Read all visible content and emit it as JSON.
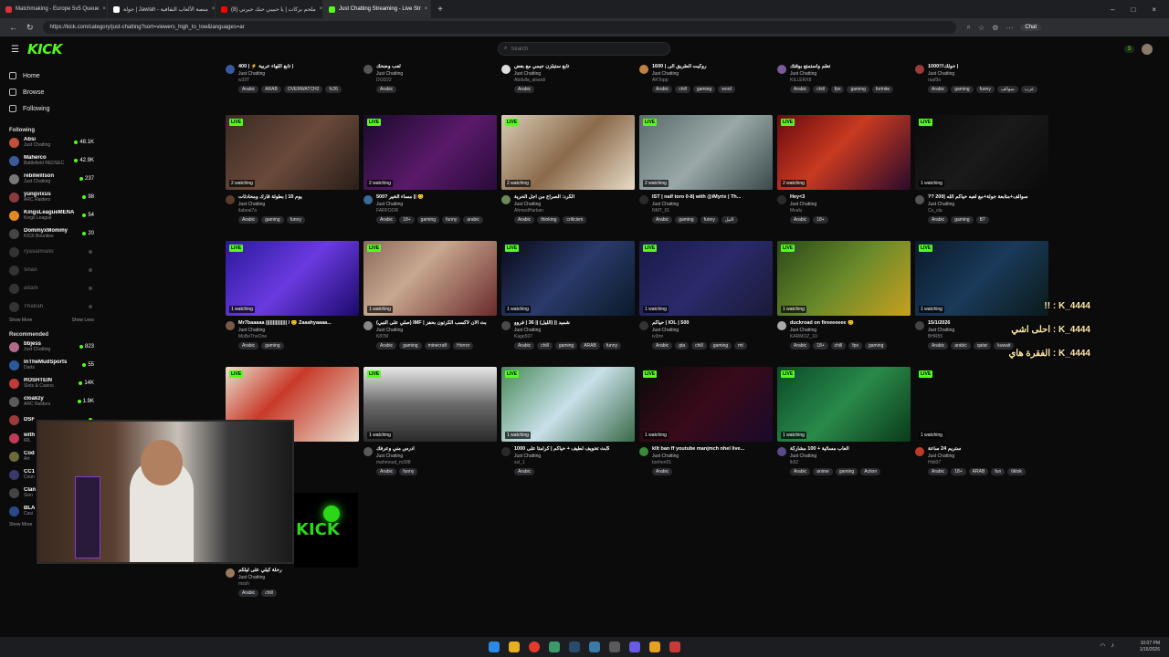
{
  "browser": {
    "tabs": [
      {
        "label": "Matchmaking - Europe 5v5 Queue",
        "color": "#e0313b"
      },
      {
        "label": "جولة | Jawlah - منصة الألعاب الثقافية",
        "color": "#ffffff"
      },
      {
        "label": "ملحم بركات | يا حبيبي حبك حيرني (8)",
        "color": "#ff0000"
      },
      {
        "label": "Just Chatting Streaming - Live Str",
        "color": "#53fc18"
      }
    ],
    "url": "https://kick.com/category/just-chatting?sort=viewers_high_to_low&languages=ar",
    "chat_label": "Chat"
  },
  "header": {
    "logo": "KICK",
    "search_placeholder": "Search",
    "notif_count": "3"
  },
  "sidebar": {
    "nav": [
      {
        "label": "Home"
      },
      {
        "label": "Browse"
      },
      {
        "label": "Following"
      }
    ],
    "following_title": "Following",
    "following": [
      {
        "name": "Absi",
        "category": "Just Chatting",
        "viewers": "48.1K",
        "color": "#c0503a",
        "online": true
      },
      {
        "name": "Maherco",
        "category": "Battlefield REDSEC",
        "viewers": "42.9K",
        "color": "#3a5a9a",
        "online": true
      },
      {
        "name": "rebilwillson",
        "category": "Just Chatting",
        "viewers": "237",
        "color": "#777",
        "online": true
      },
      {
        "name": "yungvixus",
        "category": "ARC Raiders",
        "viewers": "98",
        "color": "#8a3a3a",
        "online": true
      },
      {
        "name": "KingsLeagueMENA",
        "category": "Kings League",
        "viewers": "54",
        "color": "#e08a20",
        "online": true
      },
      {
        "name": "DommyxMommy",
        "category": "KICK Bounties",
        "viewers": "20",
        "color": "#444",
        "online": true
      },
      {
        "name": "ryasalmalki",
        "category": "",
        "viewers": "",
        "color": "#333",
        "online": false
      },
      {
        "name": "Snan",
        "category": "",
        "viewers": "",
        "color": "#333",
        "online": false
      },
      {
        "name": "aitam",
        "category": "",
        "viewers": "",
        "color": "#333",
        "online": false
      },
      {
        "name": "Thabah",
        "category": "",
        "viewers": "",
        "color": "#333",
        "online": false
      }
    ],
    "show_more": "Show More",
    "show_less": "Show Less",
    "recommended_title": "Recommended",
    "recommended": [
      {
        "name": "bbjess",
        "category": "Just Chatting",
        "viewers": "823",
        "color": "#b06a8a"
      },
      {
        "name": "InTheMudSports",
        "category": "Darts",
        "viewers": "55",
        "color": "#2a5a9a"
      },
      {
        "name": "ROSHTEIN",
        "category": "Slots & Casino",
        "viewers": "14K",
        "color": "#c03a3a"
      },
      {
        "name": "cloakzy",
        "category": "ARC Raiders",
        "viewers": "1.9K",
        "color": "#5a5a5a"
      },
      {
        "name": "DSF",
        "category": "",
        "viewers": "",
        "color": "#9a3a3a"
      },
      {
        "name": "with",
        "category": "IRL",
        "viewers": "",
        "color": "#c03a5a"
      },
      {
        "name": "Cod",
        "category": "Art",
        "viewers": "",
        "color": "#6a6a3a"
      },
      {
        "name": "CC1",
        "category": "Coun",
        "viewers": "",
        "color": "#3a3a6a"
      },
      {
        "name": "Clan",
        "category": "Sion",
        "viewers": "",
        "color": "#444"
      },
      {
        "name": "BLA",
        "category": "Casi",
        "viewers": "",
        "color": "#2a4a8a"
      }
    ],
    "show_more_2": "Show More"
  },
  "partial_row": [
    {
      "title": "400 | ⚡ تابع اللهاء عربية |",
      "category": "Just Chatting",
      "channel": "w33T",
      "tags": [
        "Arabic",
        "ARAB",
        "OVERWATCH2",
        "fc26"
      ],
      "color": "#3a5aa0"
    },
    {
      "title": "لعب وضحك",
      "category": "Just Chatting",
      "channel": "DOD22",
      "tags": [
        "Arabic"
      ],
      "color": "#555"
    },
    {
      "title": "تابع ستيلزن جيمي مع بعض",
      "category": "Just Chatting",
      "channel": "Abdulla_alsardi",
      "tags": [
        "Arabic"
      ],
      "color": "#ddd"
    },
    {
      "title": "1600 | روكيت الطريق الى",
      "category": "Just Chatting",
      "channel": "AKTopp",
      "tags": [
        "Arabic",
        "chill",
        "gaming",
        "word"
      ],
      "color": "#c08040"
    },
    {
      "title": "تعلم واستمتع بوقتك",
      "category": "Just Chatting",
      "channel": "KILLERX8",
      "tags": [
        "Arabic",
        "chill",
        "fps",
        "gaming",
        "fortnite"
      ],
      "color": "#7a5a9a"
    },
    {
      "title": "حولك!!!1000 |",
      "category": "Just Chatting",
      "channel": "raaf3o",
      "tags": [
        "Arabic",
        "gaming",
        "funny",
        "سوالف",
        "عرب"
      ],
      "color": "#9a3a3a"
    }
  ],
  "rows": [
    [
      {
        "title": "يوم 10 | بطولة قارك ومحادثات",
        "category": "Just Chatting",
        "channel": "ilaboal7a",
        "watching": "2 watching",
        "tags": [
          "Arabic",
          "gaming",
          "funny"
        ],
        "thumb": "linear-gradient(135deg,#3a2a24,#6a4a3a 50%,#2a1e1a)",
        "av": "#5a3a2a"
      },
      {
        "title": "500? مساء الخير || 😊",
        "category": "Just Chatting",
        "channel": "FARFOOR",
        "watching": "2 watching",
        "tags": [
          "Arabic",
          "18+",
          "gaming",
          "funny",
          "arabic"
        ],
        "thumb": "linear-gradient(135deg,#1a0a2a,#5a1a6a 55%,#2a0a3a)",
        "av": "#3a6a9a"
      },
      {
        "title": "الكرد: الصراع من أجل الحرية",
        "category": "Just Chatting",
        "channel": "AhmedHarkan",
        "watching": "2 watching",
        "tags": [
          "Arabic",
          "thinking",
          "criticism"
        ],
        "thumb": "linear-gradient(135deg,#d8cbb5,#8a6a4a 50%,#e8dcc8)",
        "av": "#6a8a5a"
      },
      {
        "title": "IST | nalf toro 0-8| with @iMyrix | Th...",
        "category": "Just Chatting",
        "channel": "NMT_01",
        "watching": "2 watching",
        "tags": [
          "Arabic",
          "gaming",
          "funny",
          "التيل"
        ],
        "thumb": "linear-gradient(135deg,#5a6a6a,#9aa8a8 50%,#3a4a4a)",
        "av": "#2a2a2a"
      },
      {
        "title": "Hey<3",
        "category": "Just Chatting",
        "channel": "Mvalu",
        "watching": "2 watching",
        "tags": [
          "Arabic",
          "18+"
        ],
        "thumb": "linear-gradient(135deg,#6a0a10,#c83a20 45%,#2a0a2a)",
        "av": "#2a2a2a"
      },
      {
        "title": "?? 200| سوالف+متابعة جولة+مع لعبه حياكم الله",
        "category": "Just Chatting",
        "channel": "Cs_ola",
        "watching": "1 watching",
        "tags": [
          "Arabic",
          "gaming",
          "B7"
        ],
        "thumb": "linear-gradient(135deg,#0a0a0a,#1a1a1a 50%,#0a0a0a)",
        "av": "#555"
      }
    ],
    [
      {
        "title": "Mr7baaaaa ||||||||||||||| / 😊 Zaaahyaaaa...",
        "category": "Just Chatting",
        "channel": "MoBeTheOne",
        "watching": "1 watching",
        "tags": [
          "Arabic",
          "gaming"
        ],
        "thumb": "linear-gradient(135deg,#2a1a9a,#6a3ae0 50%,#1a0a6a)",
        "av": "#7a5a4a"
      },
      {
        "title": "(صلي على النبي) IMF | بث الان لاكسب الكرتون بحفز",
        "category": "Just Chatting",
        "channel": "K87M",
        "watching": "1 watching",
        "tags": [
          "Arabic",
          "gaming",
          "minecraft",
          "Horror"
        ],
        "thumb": "linear-gradient(135deg,#8a6a5a,#c8a890 40%,#6a2a2a)",
        "av": "#888"
      },
      {
        "title": "شميد || (الليل) || 36 | فروو",
        "category": "Just Chatting",
        "channel": "Kage507",
        "watching": "1 watching",
        "tags": [
          "Arabic",
          "chill",
          "gaming",
          "ARAB",
          "funny"
        ],
        "thumb": "linear-gradient(135deg,#0a0a1a,#2a3a6a 50%,#0a1a2a)",
        "av": "#4a4a4a"
      },
      {
        "title": "حياكم | IOL | 500",
        "category": "Just Chatting",
        "channel": "iv3mr",
        "watching": "1 watching",
        "tags": [
          "Arabic",
          "gta",
          "chill",
          "gaming",
          "mt"
        ],
        "thumb": "linear-gradient(135deg,#1a1a4a,#2a2a6a 50%,#1a1a3a)",
        "av": "#333"
      },
      {
        "title": "duckroad on fireeeeeee 😊",
        "category": "Just Chatting",
        "channel": "KARMOZ_10",
        "watching": "1 watching",
        "tags": [
          "Arabic",
          "18+",
          "chill",
          "fps",
          "gaming"
        ],
        "thumb": "linear-gradient(135deg,#2a4a1a,#6a8a2a 50%,#c8a020)",
        "av": "#aaa"
      },
      {
        "title": "15/1/2026",
        "category": "Just Chatting",
        "channel": "BHR55",
        "watching": "1 watching",
        "tags": [
          "Arabic",
          "arabic",
          "qatar",
          "kuwait"
        ],
        "thumb": "linear-gradient(135deg,#0a1a2a,#1a3a5a 50%,#0a1a1a)",
        "av": "#444"
      }
    ],
    [
      {
        "title": "رحلة كيلي على ليلكم",
        "category": "Just Chatting",
        "channel": "mssh",
        "watching": "1 watching",
        "tags": [
          "Arabic",
          "chill"
        ],
        "thumb": "linear-gradient(135deg,#e8e0d0,#c83a2a 40%,#e8e0d0)",
        "av": "#9a7a5a"
      },
      {
        "title": "ادرس مني وعرفك",
        "category": "Just Chatting",
        "channel": "mahmoud_m398",
        "watching": "1 watching",
        "tags": [
          "Arabic",
          "funny"
        ],
        "thumb": "linear-gradient(180deg,#e8e8e8,#6a6a6a 50%,#2a2a2a)",
        "av": "#5a5a5a"
      },
      {
        "title": "بث تخويف لطيف + حياكم | كرامتا على 1000$",
        "category": "Just Chatting",
        "channel": "ssl_1",
        "watching": "1 watching",
        "tags": [
          "Arabic"
        ],
        "thumb": "linear-gradient(135deg,#4a8a5a,#c8e0e8 50%,#3a6a4a)",
        "av": "#2a2a2a"
      },
      {
        "title": "kllt ban ff youtube manjmch nhel live...",
        "category": "Just Chatting",
        "channel": "borhen01",
        "watching": "1 watching",
        "tags": [
          "Arabic"
        ],
        "thumb": "linear-gradient(135deg,#0a0a0a,#3a0a1a 50%,#1a0a2a)",
        "av": "#3a8a3a"
      },
      {
        "title": "العاب مسائية + 100 مشاركة",
        "category": "Just Chatting",
        "channel": "lk52",
        "watching": "1 watching",
        "tags": [
          "Arabic",
          "anime",
          "gaming",
          "Action"
        ],
        "thumb": "linear-gradient(135deg,#0a4a2a,#2a8a4a 50%,#0a3a1a)",
        "av": "#5a4a8a"
      },
      {
        "title": "ستريم 24 ساعة",
        "category": "Just Chatting",
        "channel": "Hidi37",
        "watching": "1 watching",
        "tags": [
          "Arabic",
          "18+",
          "ARAB",
          "fun",
          "tiktok"
        ],
        "thumb": "linear-gradient(135deg,#0b0b0c,#0b0b0c)",
        "av": "#c03a2a"
      }
    ]
  ],
  "live_label": "LIVE",
  "chat_overlay": [
    "K_4444 : !!",
    "K_4444 : احلى اشي",
    "K_4444 : الفقرة هاي"
  ],
  "taskbar_clock": {
    "time": "10:07 PM",
    "date": "1/15/2026"
  }
}
